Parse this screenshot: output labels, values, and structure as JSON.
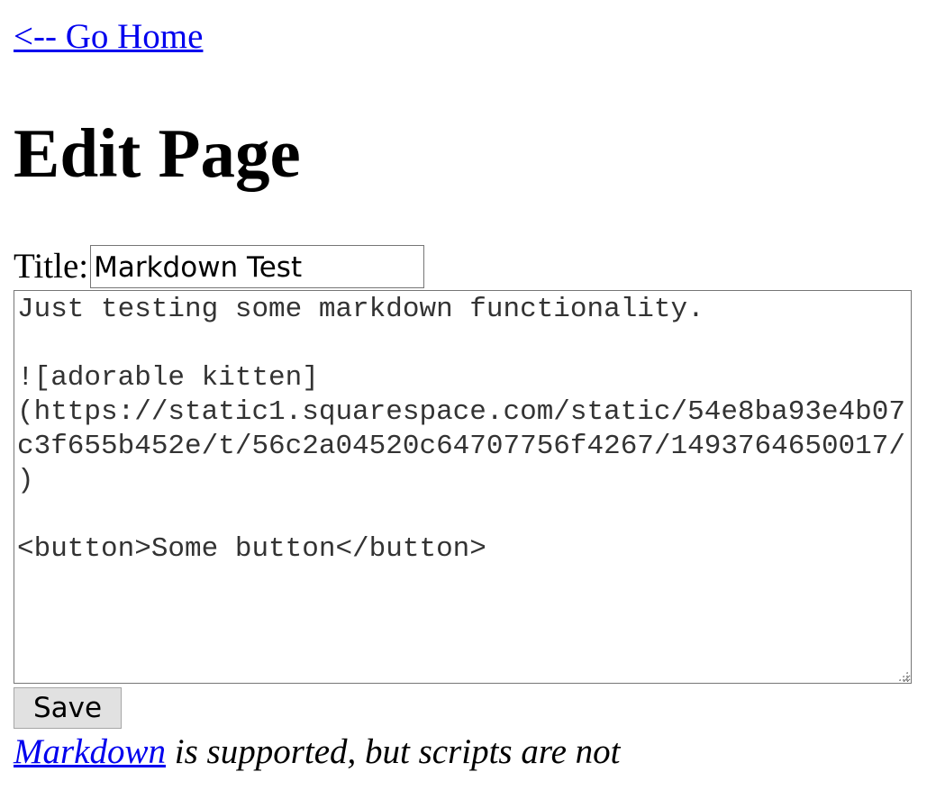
{
  "nav": {
    "home_link": "<-- Go Home"
  },
  "page": {
    "heading": "Edit Page"
  },
  "form": {
    "title_label": "Title:",
    "title_value": "Markdown Test",
    "body_value": "Just testing some markdown functionality.\n\n![adorable kitten](https://static1.squarespace.com/static/54e8ba93e4b07c3f655b452e/t/56c2a04520c64707756f4267/1493764650017/)\n\n<button>Some button</button>",
    "save_label": "Save"
  },
  "footer": {
    "markdown_link": "Markdown",
    "note": " is supported, but scripts are not"
  },
  "colors": {
    "link": "#0000ee",
    "button_bg": "#e1e1e1",
    "field_border": "#767676"
  }
}
